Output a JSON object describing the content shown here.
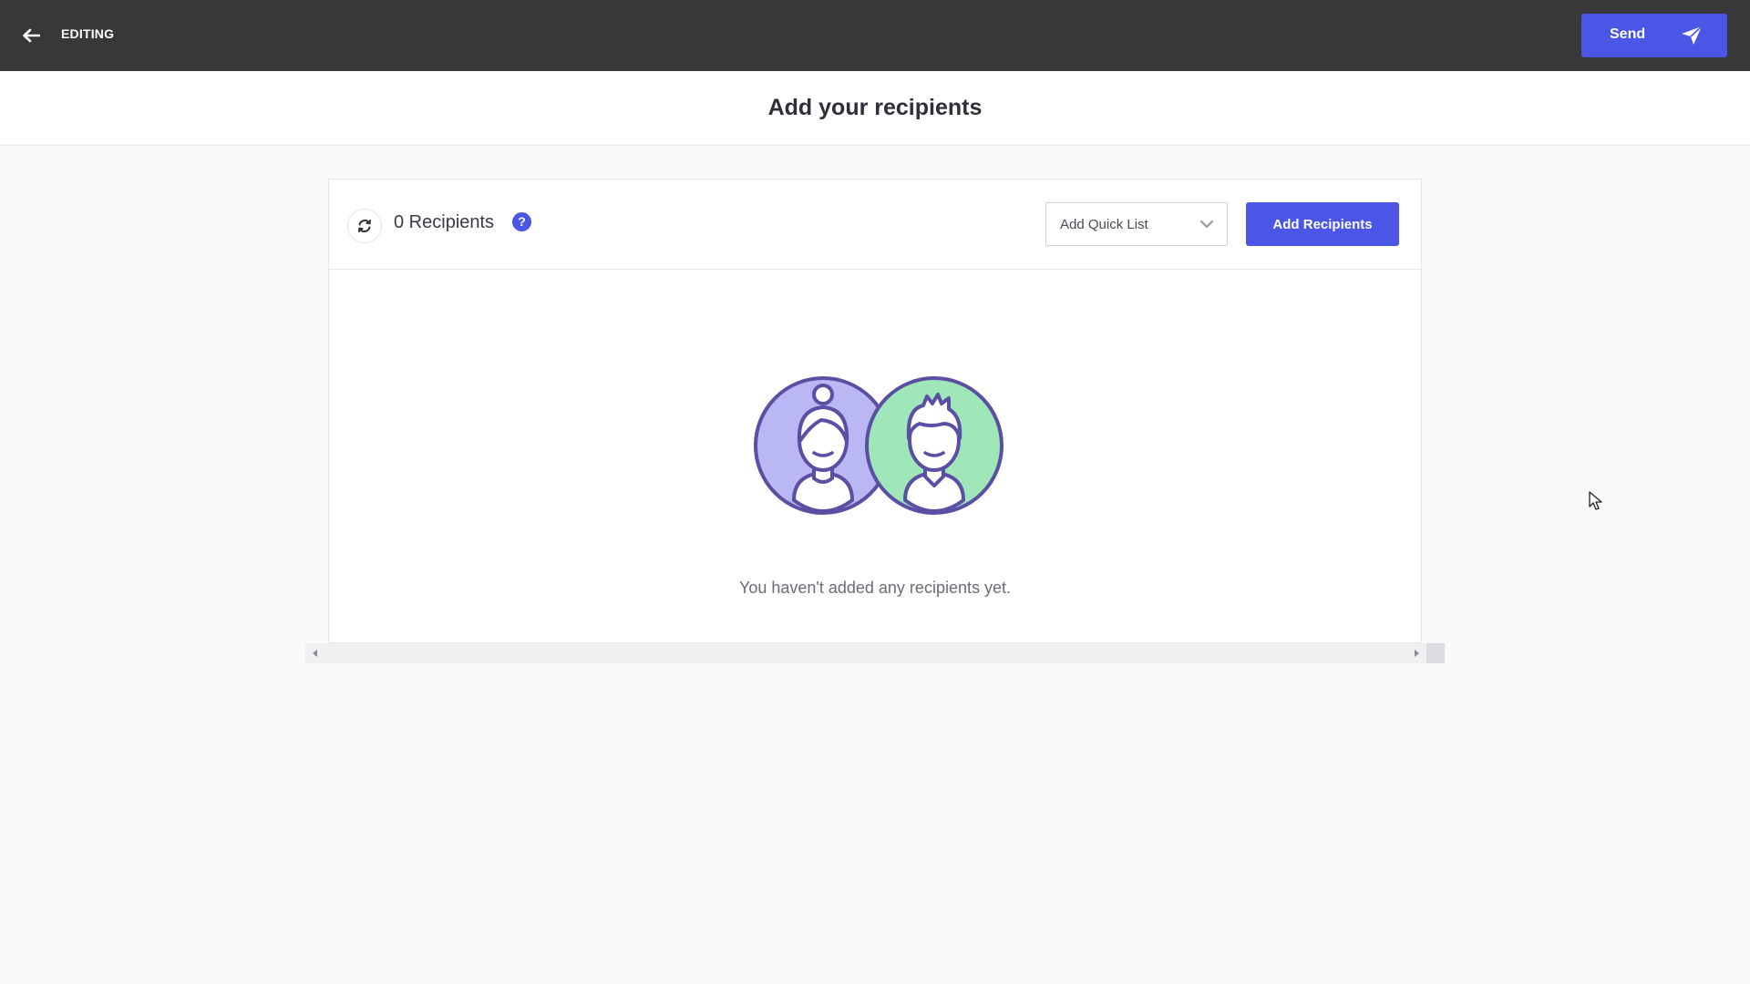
{
  "topbar": {
    "editing_label": "EDITING",
    "send_label": "Send",
    "back_icon": "arrow-left-icon",
    "send_icon": "paper-plane-icon"
  },
  "header": {
    "title": "Add your recipients"
  },
  "recipients": {
    "count_text": "0 Recipients",
    "help_symbol": "?",
    "quick_list_label": "Add Quick List",
    "add_button_label": "Add Recipients",
    "empty_message": "You haven't added any recipients yet.",
    "refresh_icon": "refresh-icon",
    "illustration_icon": "people-avatars-icon"
  },
  "colors": {
    "accent": "#4b55e6",
    "topbar": "#383838",
    "avatar_female_bg": "#b9b8f5",
    "avatar_male_bg": "#9fe6b8",
    "avatar_stroke": "#5b4fa3"
  }
}
